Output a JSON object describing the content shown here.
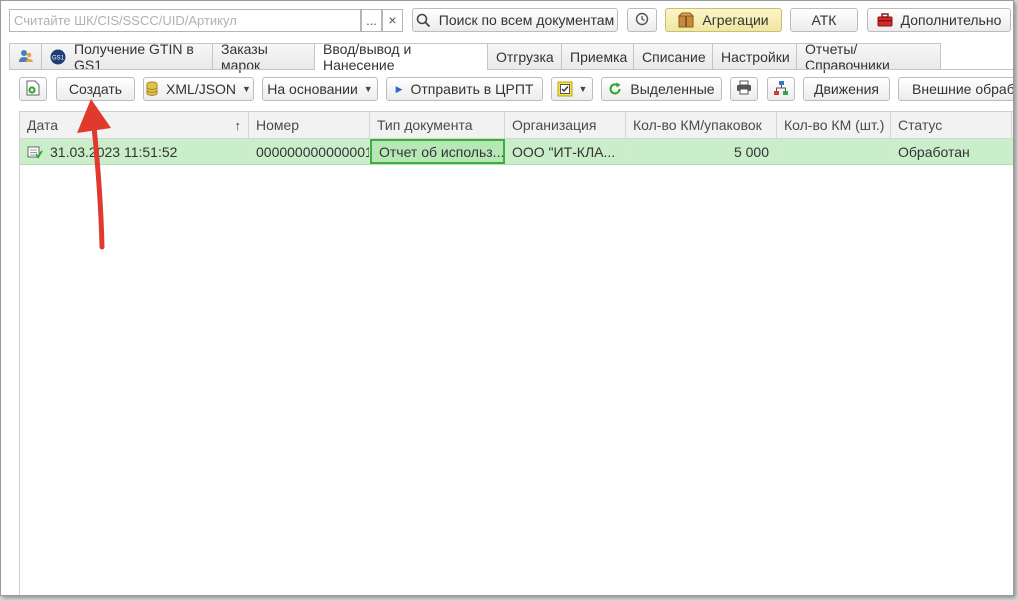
{
  "search": {
    "placeholder": "Считайте ШК/CIS/SSCC/UID/Артикул",
    "dots": "...",
    "clear": "×"
  },
  "header_buttons": {
    "search_all": "Поиск по всем документам",
    "aggregation": "Агрегации",
    "atk": "АТК",
    "additional": "Дополнительно"
  },
  "tabs": [
    {
      "label": ""
    },
    {
      "label": "Получение GTIN в GS1"
    },
    {
      "label": "Заказы марок"
    },
    {
      "label": "Ввод/вывод и Нанесение"
    },
    {
      "label": "Отгрузка"
    },
    {
      "label": "Приемка"
    },
    {
      "label": "Списание"
    },
    {
      "label": "Настройки"
    },
    {
      "label": "Отчеты/Справочники"
    }
  ],
  "toolbar": {
    "create": "Создать",
    "xml_json": "XML/JSON",
    "based_on": "На основании",
    "send": "Отправить в ЦРПТ",
    "selected": "Выделенные",
    "movements": "Движения",
    "external": "Внешние обработки"
  },
  "columns": [
    {
      "label": "Дата",
      "sort": "↑"
    },
    {
      "label": "Номер"
    },
    {
      "label": "Тип документа"
    },
    {
      "label": "Организация"
    },
    {
      "label": "Кол-во КМ/упаковок"
    },
    {
      "label": "Кол-во КМ (шт.)"
    },
    {
      "label": "Статус"
    }
  ],
  "rows": [
    {
      "date": "31.03.2023 11:51:52",
      "number": "000000000000001",
      "doc_type": "Отчет об использ...",
      "org": "ООО \"ИТ-КЛА...",
      "km_packs": "5 000",
      "km_pcs": "",
      "status": "Обработан"
    }
  ],
  "colors": {
    "row_highlight": "#c9eec9",
    "annotation_arrow": "#e03a2f"
  }
}
